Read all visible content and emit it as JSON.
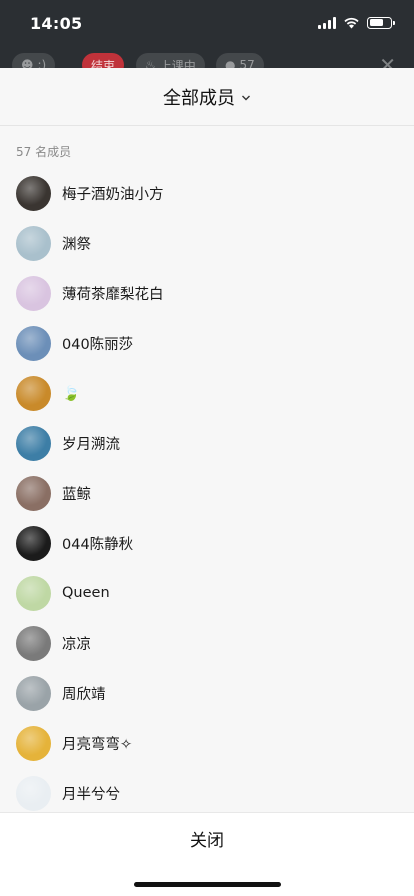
{
  "status_bar": {
    "time": "14:05"
  },
  "background_toolbar": {
    "pill_1": ":)",
    "pill_2": "结束",
    "pill_3": "上课中",
    "pill_4": "57"
  },
  "sheet": {
    "title": "全部成员",
    "member_count": "57 名成员",
    "close_label": "关闭"
  },
  "members": [
    {
      "name": "梅子酒奶油小方",
      "avatar": "#3a3531"
    },
    {
      "name": "渊祭",
      "avatar": "#a9c0cc"
    },
    {
      "name": "薄荷茶靡梨花白",
      "avatar": "#d9c4e0"
    },
    {
      "name": "040陈丽莎",
      "avatar": "#6c8fb8"
    },
    {
      "name": "🍃",
      "avatar": "#c98a2a"
    },
    {
      "name": "岁月溯流",
      "avatar": "#3d7ea6"
    },
    {
      "name": "蓝鲸",
      "avatar": "#8a6f64"
    },
    {
      "name": "044陈静秋",
      "avatar": "#1b1b1b"
    },
    {
      "name": "Queen",
      "avatar": "#bfd8a4"
    },
    {
      "name": "凉凉",
      "avatar": "#7a7a7a"
    },
    {
      "name": "周欣靖",
      "avatar": "#9aa3a8"
    },
    {
      "name": "月亮弯弯✧",
      "avatar": "#e5b33a"
    },
    {
      "name": "月半兮兮",
      "avatar": "#e9eef2"
    }
  ]
}
